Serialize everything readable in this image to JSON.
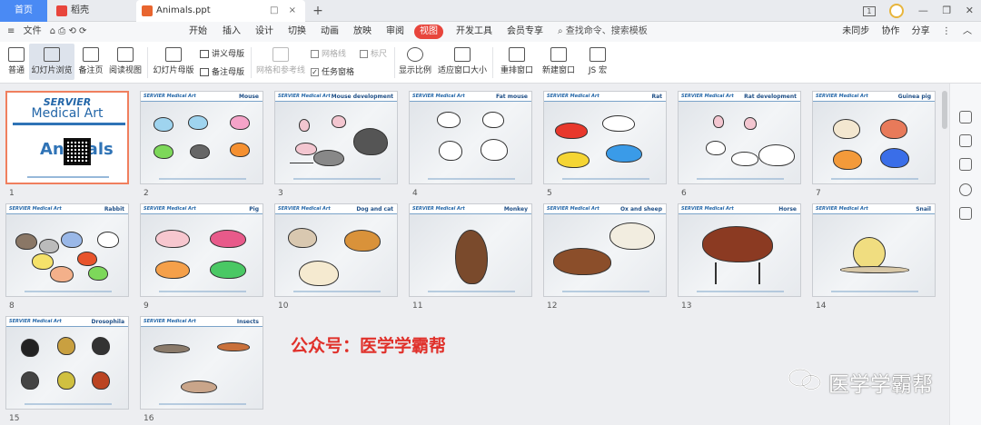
{
  "titlebar": {
    "home_tab": "首页",
    "wps_tab": "稻壳",
    "doc_tab": "Animals.ppt",
    "doc_tab_icons": "□ ×",
    "new_tab": "+",
    "window_badge": "1",
    "controls": [
      "—",
      "❐",
      "✕"
    ]
  },
  "menubar": {
    "file_menu": "文件",
    "quick_icons": "⌂ ⎙ ⟲ ⟳",
    "tabs": [
      "开始",
      "插入",
      "设计",
      "切换",
      "动画",
      "放映",
      "审阅",
      "视图",
      "开发工具",
      "会员专享"
    ],
    "active_tab": "视图",
    "search_placeholder": "查找命令、搜索模板",
    "right_items": [
      "未同步",
      "协作",
      "分享"
    ]
  },
  "ribbon": {
    "big_buttons": [
      "普通",
      "幻灯片浏览",
      "备注页",
      "阅读视图",
      "幻灯片母版",
      "网格和参考线",
      "显示比例",
      "适应窗口大小",
      "重排窗口",
      "新建窗口",
      "JS 宏"
    ],
    "small_buttons": {
      "handout_master": "讲义母版",
      "notes_master": "备注母版",
      "gridlines": "网格线",
      "ruler": "标尺",
      "task_pane": "任务窗格"
    }
  },
  "slides": [
    {
      "num": "1",
      "title": "",
      "brand": "SERVIER",
      "kind": "title"
    },
    {
      "num": "2",
      "title": "Mouse",
      "brand": "SERVIER Medical Art"
    },
    {
      "num": "3",
      "title": "Mouse development",
      "brand": "SERVIER Medical Art"
    },
    {
      "num": "4",
      "title": "Fat mouse",
      "brand": "SERVIER Medical Art"
    },
    {
      "num": "5",
      "title": "Rat",
      "brand": "SERVIER Medical Art"
    },
    {
      "num": "6",
      "title": "Rat development",
      "brand": "SERVIER Medical Art"
    },
    {
      "num": "7",
      "title": "Guinea pig",
      "brand": "SERVIER Medical Art"
    },
    {
      "num": "8",
      "title": "Rabbit",
      "brand": "SERVIER Medical Art"
    },
    {
      "num": "9",
      "title": "Pig",
      "brand": "SERVIER Medical Art"
    },
    {
      "num": "10",
      "title": "Dog and cat",
      "brand": "SERVIER Medical Art"
    },
    {
      "num": "11",
      "title": "Monkey",
      "brand": "SERVIER Medical Art"
    },
    {
      "num": "12",
      "title": "Ox and sheep",
      "brand": "SERVIER Medical Art"
    },
    {
      "num": "13",
      "title": "Horse",
      "brand": "SERVIER Medical Art"
    },
    {
      "num": "14",
      "title": "Snail",
      "brand": "SERVIER Medical Art"
    },
    {
      "num": "15",
      "title": "Drosophila",
      "brand": "SERVIER Medical Art"
    },
    {
      "num": "16",
      "title": "Insects",
      "brand": "SERVIER Medical Art"
    }
  ],
  "title_slide": {
    "brand": "SERVIER",
    "subtitle": "Medical Art",
    "big_text": "Animals"
  },
  "watermarks": {
    "red_text": "公众号：医学学霸帮",
    "logo_text": "医学学霸帮"
  },
  "colors": {
    "accent": "#e8453c",
    "selected_border": "#f07f5e",
    "brand_blue": "#2366a8"
  }
}
